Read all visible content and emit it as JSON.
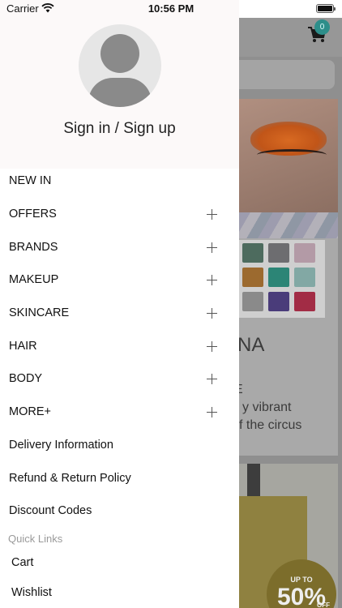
{
  "status_bar": {
    "carrier": "Carrier",
    "time": "10:56 PM"
  },
  "drawer": {
    "signin_label": "Sign in / Sign up",
    "menu": [
      {
        "label": "NEW IN",
        "expandable": false
      },
      {
        "label": "OFFERS",
        "expandable": true
      },
      {
        "label": "BRANDS",
        "expandable": true
      },
      {
        "label": "MAKEUP",
        "expandable": true
      },
      {
        "label": "SKINCARE",
        "expandable": true
      },
      {
        "label": "HAIR",
        "expandable": true
      },
      {
        "label": "BODY",
        "expandable": true
      },
      {
        "label": "MORE+",
        "expandable": true
      },
      {
        "label": "Delivery Information",
        "expandable": false
      },
      {
        "label": "Refund & Return Policy",
        "expandable": false
      },
      {
        "label": "Discount Codes",
        "expandable": false
      }
    ],
    "quick_links": {
      "title": "Quick Links",
      "items": [
        "Cart",
        "Wishlist"
      ]
    }
  },
  "background_app": {
    "cart_count": "0",
    "banner_text": {
      "brand_fragment": "NA",
      "line_e": "E",
      "line1": "y vibrant",
      "line2": "f the circus"
    },
    "promo_badge": {
      "up_to": "UP TO",
      "percent": "50%",
      "off": "OFF"
    }
  },
  "colors": {
    "badge": "#2d8e8a",
    "overlay": "#8f8f8f",
    "drawer_header_bg": "#fcf9f9"
  }
}
